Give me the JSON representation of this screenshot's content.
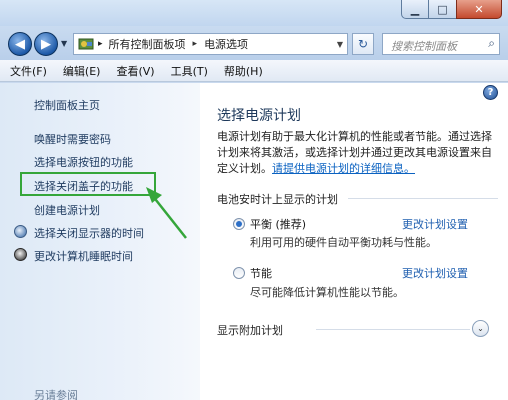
{
  "address": {
    "crumbs": [
      "所有控制面板项",
      "电源选项"
    ],
    "search_placeholder": "搜索控制面板"
  },
  "menu": [
    "文件(F)",
    "编辑(E)",
    "查看(V)",
    "工具(T)",
    "帮助(H)"
  ],
  "sidebar": {
    "home": "控制面板主页",
    "links": [
      "唤醒时需要密码",
      "选择电源按钮的功能",
      "选择关闭盖子的功能",
      "创建电源计划",
      "选择关闭显示器的时间",
      "更改计算机睡眠时间"
    ],
    "see_also": "另请参阅"
  },
  "main": {
    "title": "选择电源计划",
    "intro": "电源计划有助于最大化计算机的性能或者节能。通过选择计划来将其激活，或选择计划并通过更改其电源设置来自定义计划。",
    "intro_link": "请提供电源计划的详细信息。",
    "battery_group": "电池安时计上显示的计划",
    "plans": [
      {
        "name": "平衡 (推荐)",
        "desc": "利用可用的硬件自动平衡功耗与性能。",
        "link": "更改计划设置",
        "selected": true
      },
      {
        "name": "节能",
        "desc": "尽可能降低计算机性能以节能。",
        "link": "更改计划设置",
        "selected": false
      }
    ],
    "extra_group": "显示附加计划"
  },
  "colors": {
    "highlight": "#35a63a",
    "link": "#1f5fb0"
  }
}
